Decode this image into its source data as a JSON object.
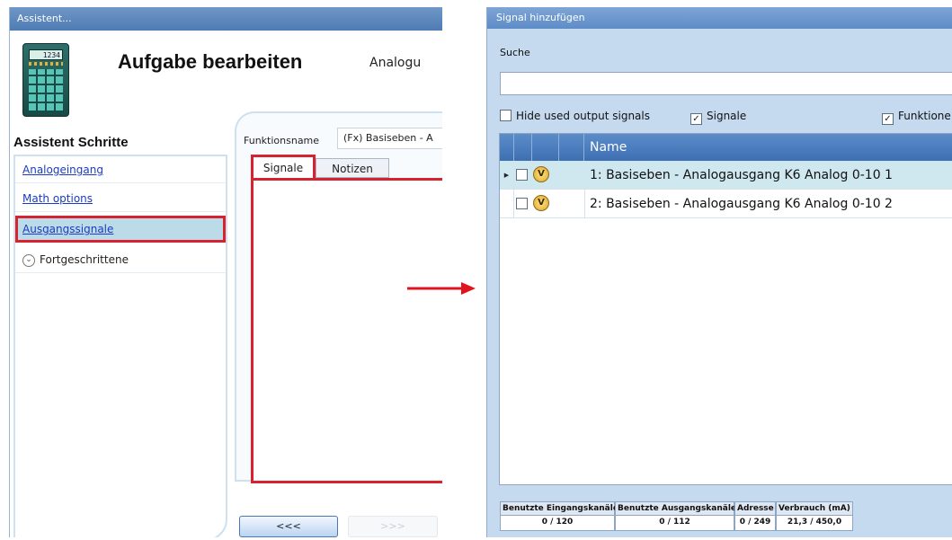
{
  "left_window": {
    "title": "Assistent...",
    "header_title": "Aufgabe bearbeiten",
    "header_subtitle": "Analogu",
    "calc_display": "1234",
    "sidebar_heading": "Assistent Schritte",
    "sidebar_items": [
      {
        "label": "Analogeingang"
      },
      {
        "label": "Math options"
      },
      {
        "label": "Ausgangssignale"
      },
      {
        "label": "Fortgeschrittene"
      }
    ],
    "function_name_label": "Funktionsname",
    "function_name_value": "(Fx) Basiseben - A",
    "tabs": [
      {
        "label": "Signale"
      },
      {
        "label": "Notizen"
      }
    ],
    "back_button": "<<<",
    "next_button": ">>>"
  },
  "right_window": {
    "title": "Signal hinzufügen",
    "search_label": "Suche",
    "search_value": "",
    "checkboxes": [
      {
        "label": "Hide used output signals",
        "checked": false
      },
      {
        "label": "Signale",
        "checked": true
      },
      {
        "label": "Funktione",
        "checked": true
      }
    ],
    "grid_header_name": "Name",
    "rows": [
      {
        "name": "1: Basiseben - Analogausgang K6 Analog 0-10 1",
        "icon": "V"
      },
      {
        "name": "2: Basiseben - Analogausgang K6 Analog 0-10 2",
        "icon": "V"
      }
    ],
    "status": [
      {
        "label": "Benutzte Eingangskanäle",
        "value": "0 / 120"
      },
      {
        "label": "Benutzte Ausgangskanäle",
        "value": "0 / 112"
      },
      {
        "label": "Adresse",
        "value": "0 / 249"
      },
      {
        "label": "Verbrauch (mA)",
        "value": "21,3 / 450,0"
      }
    ]
  },
  "colors": {
    "highlight_red": "#d6232f",
    "titlebar_blue": "#5e8cc7",
    "panel_blue": "#c5d9ef",
    "link_blue": "#1a3cc2"
  },
  "icons": [
    "calculator-icon",
    "chevron-down-icon",
    "row-pointer-icon",
    "variable-v-icon",
    "arrow-right-icon"
  ]
}
